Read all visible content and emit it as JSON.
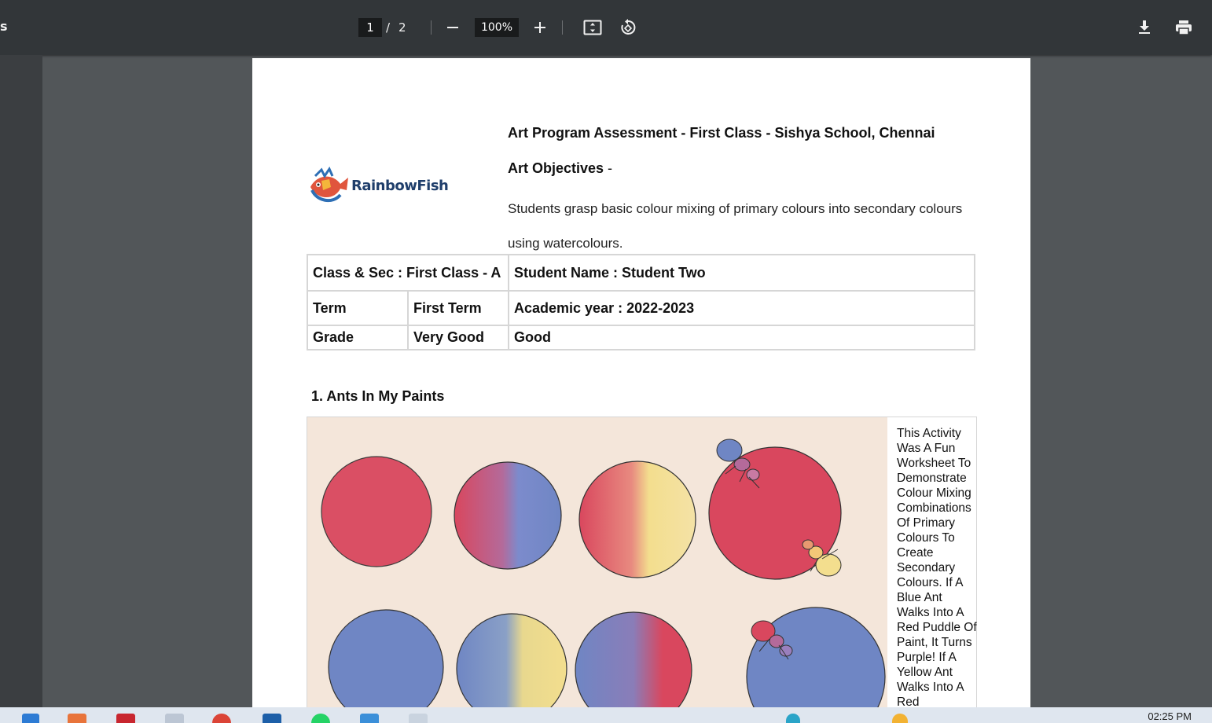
{
  "toolbar": {
    "title_fragment": "s",
    "current_page": "1",
    "page_separator": "/",
    "total_pages": "2",
    "zoom": "100%",
    "icons": [
      "zoom-out-icon",
      "zoom-in-icon",
      "fit-page-icon",
      "rotate-icon",
      "download-icon",
      "print-icon"
    ]
  },
  "document": {
    "logo_text": "RainbowFish",
    "title": "Art Program Assessment - First Class - Sishya School, Chennai",
    "objectives_label": "Art Objectives",
    "objectives_dash": " -",
    "objectives_text": "Students grasp basic colour mixing of primary colours into secondary colours using watercolours.",
    "info_table": {
      "class_sec": "Class & Sec :  First Class - A",
      "student_name": "Student Name : Student Two",
      "term_label": "Term",
      "term_value": "First Term",
      "academic_year": "Academic year : 2022-2023",
      "grade_label": "Grade",
      "grade_value": "Very Good",
      "grade_remark": "Good"
    },
    "section1_title": "1. Ants In My Paints",
    "section1_description": "This Activity Was A Fun Worksheet To Demonstrate Colour Mixing Combinations Of Primary Colours To Create Secondary Colours. If A Blue Ant Walks Into A Red Puddle Of Paint, It Turns Purple! If A Yellow Ant Walks Into A Red"
  },
  "taskbar": {
    "time": "02:25 PM"
  },
  "colors": {
    "toolbar_bg": "#323639",
    "viewer_bg": "#525659",
    "paint_red": "#d9475e",
    "paint_blue": "#6f86c4",
    "paint_yellow": "#f3de8e"
  }
}
